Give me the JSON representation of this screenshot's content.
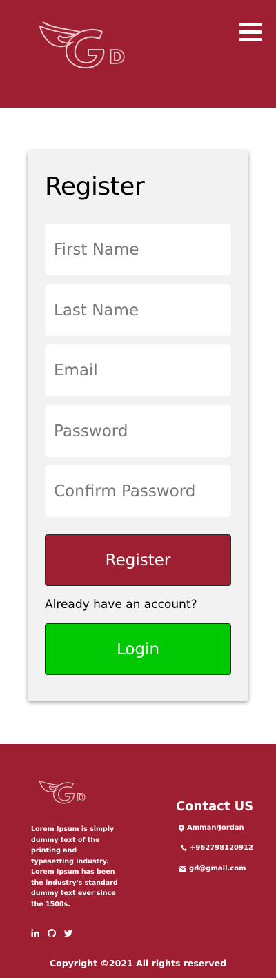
{
  "header": {
    "logo_text": "GD",
    "menu_icon": "hamburger-menu-icon"
  },
  "form": {
    "title": "Register",
    "first_name_placeholder": "First Name",
    "last_name_placeholder": "Last Name",
    "email_placeholder": "Email",
    "password_placeholder": "Password",
    "confirm_password_placeholder": "Confirm Password",
    "register_label": "Register",
    "already_text": "Already have an account?",
    "login_label": "Login"
  },
  "footer": {
    "about": "Lorem Ipsum is simply dummy text of the printing and typesetting industry. Lorem Ipsum has been the industry's standard dummy text ever since the 1500s.",
    "contact_title": "Contact US",
    "location": "Amman/Jordan",
    "phone": "+962798120912",
    "email": "gd@gmail.com",
    "social_icons": [
      "linkedin-icon",
      "github-icon",
      "twitter-icon"
    ],
    "copyright": "Copyright ©2021 All rights reserved"
  },
  "colors": {
    "brand": "#9e1f32",
    "card": "#f2f2f2",
    "login": "#00c904"
  }
}
